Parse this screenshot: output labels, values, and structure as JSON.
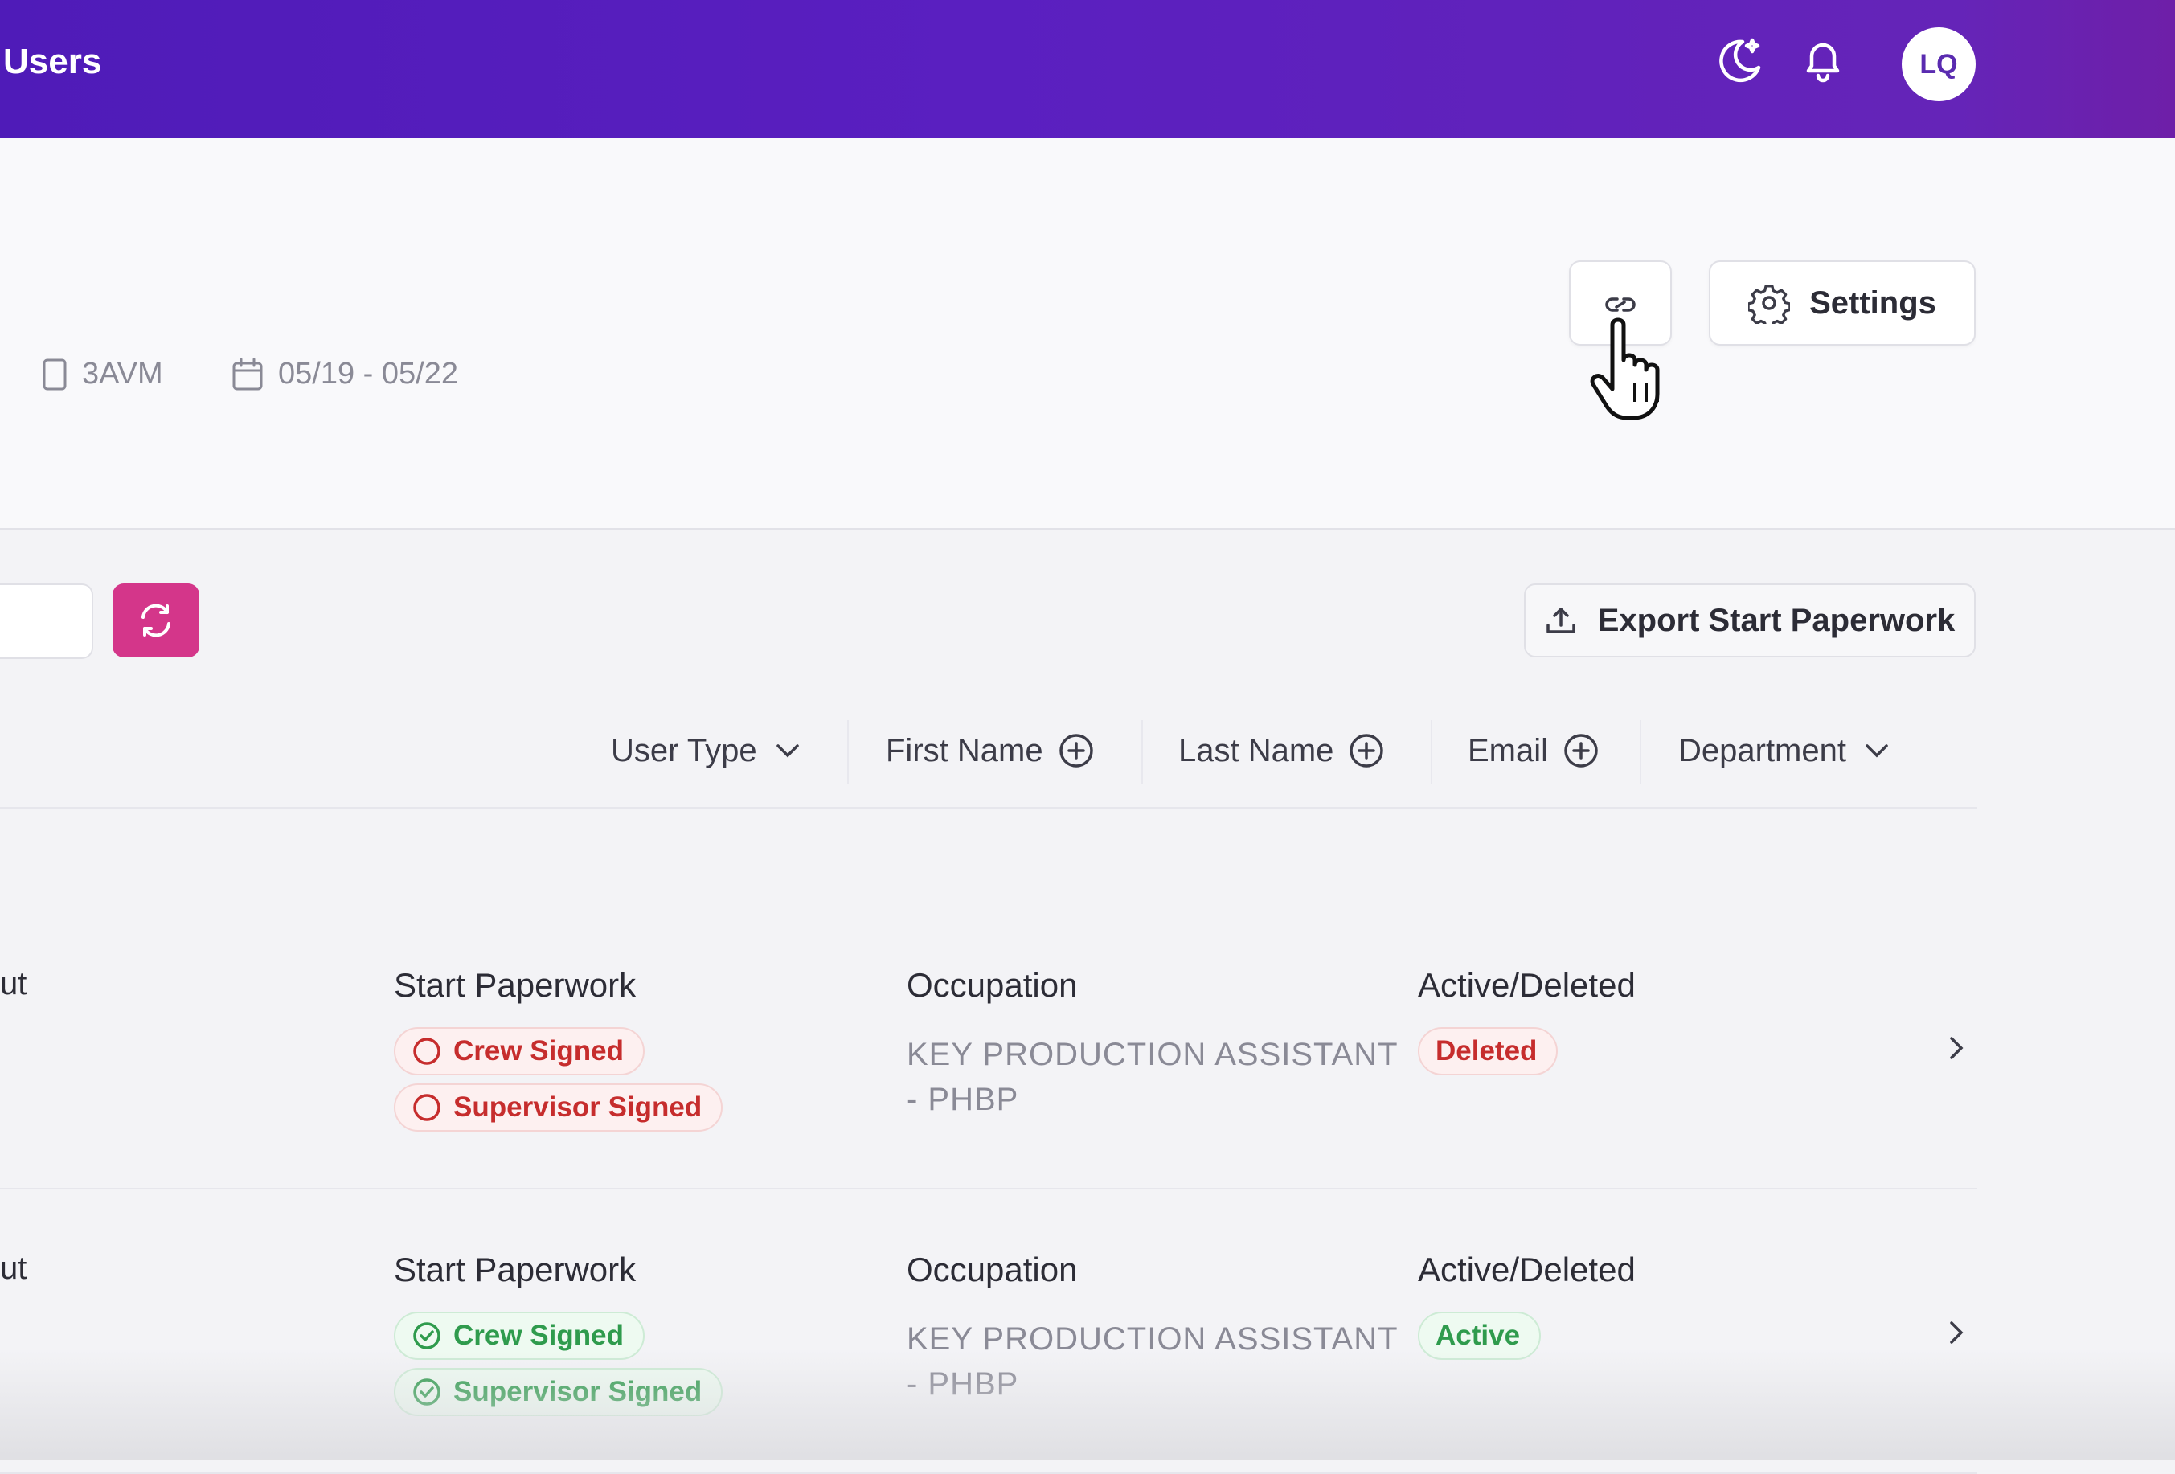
{
  "topbar": {
    "title": "Users",
    "avatar_initials": "LQ",
    "icons": [
      "moon-star-icon",
      "bell-icon"
    ]
  },
  "header": {
    "code": "3AVM",
    "dates": "05/19 - 05/22",
    "settings_label": "Settings"
  },
  "toolbar": {
    "export_label": "Export Start Paperwork",
    "refresh_color": "#d4368a"
  },
  "filters": [
    {
      "label": "User Type",
      "icon": "chevron-down-icon"
    },
    {
      "label": "First Name",
      "icon": "plus-circle-icon"
    },
    {
      "label": "Last Name",
      "icon": "plus-circle-icon"
    },
    {
      "label": "Email",
      "icon": "plus-circle-icon"
    },
    {
      "label": "Department",
      "icon": "chevron-down-icon"
    }
  ],
  "rows": [
    {
      "cut_text": "ut",
      "start_paperwork_label": "Start Paperwork",
      "crew_signed": "Crew Signed",
      "supervisor_signed": "Supervisor Signed",
      "signed_state": "unsigned",
      "occupation_label": "Occupation",
      "occupation_line1": "KEY PRODUCTION ASSISTANT",
      "occupation_line2": "- PHBP",
      "status_label": "Active/Deleted",
      "status": "Deleted"
    },
    {
      "cut_text": "ut",
      "start_paperwork_label": "Start Paperwork",
      "crew_signed": "Crew Signed",
      "supervisor_signed": "Supervisor Signed",
      "signed_state": "signed",
      "occupation_label": "Occupation",
      "occupation_line1": "KEY PRODUCTION ASSISTANT",
      "occupation_line2": "- PHBP",
      "status_label": "Active/Deleted",
      "status": "Active"
    }
  ],
  "colors": {
    "header_gradient_start": "#4f1bb8",
    "header_gradient_end": "#6e1fa8",
    "red_badge": "#c62d2d",
    "green_badge": "#2f9b4d"
  }
}
